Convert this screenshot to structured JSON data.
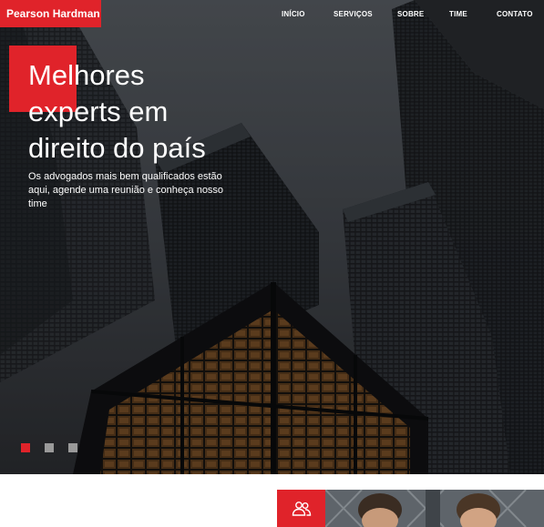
{
  "brand": {
    "name": "Pearson Hardman"
  },
  "nav": {
    "items": [
      {
        "label": "INÍCIO"
      },
      {
        "label": "SERVIÇOS"
      },
      {
        "label": "SOBRE"
      },
      {
        "label": "TIME"
      },
      {
        "label": "CONTATO"
      }
    ]
  },
  "hero": {
    "headline_lines": [
      "Melhores",
      "experts em",
      "direito do país"
    ],
    "subtitle_lines": [
      "Os advogados mais bem qualificados estão",
      "aqui, agende uma reunião e conheça nosso",
      "time"
    ]
  },
  "slider": {
    "active_index": 0,
    "count": 3
  },
  "colors": {
    "accent": "#e0232a",
    "dot_inactive": "#9a9a9a",
    "text_light": "#ffffff"
  },
  "icons": {
    "team": "people-icon"
  }
}
